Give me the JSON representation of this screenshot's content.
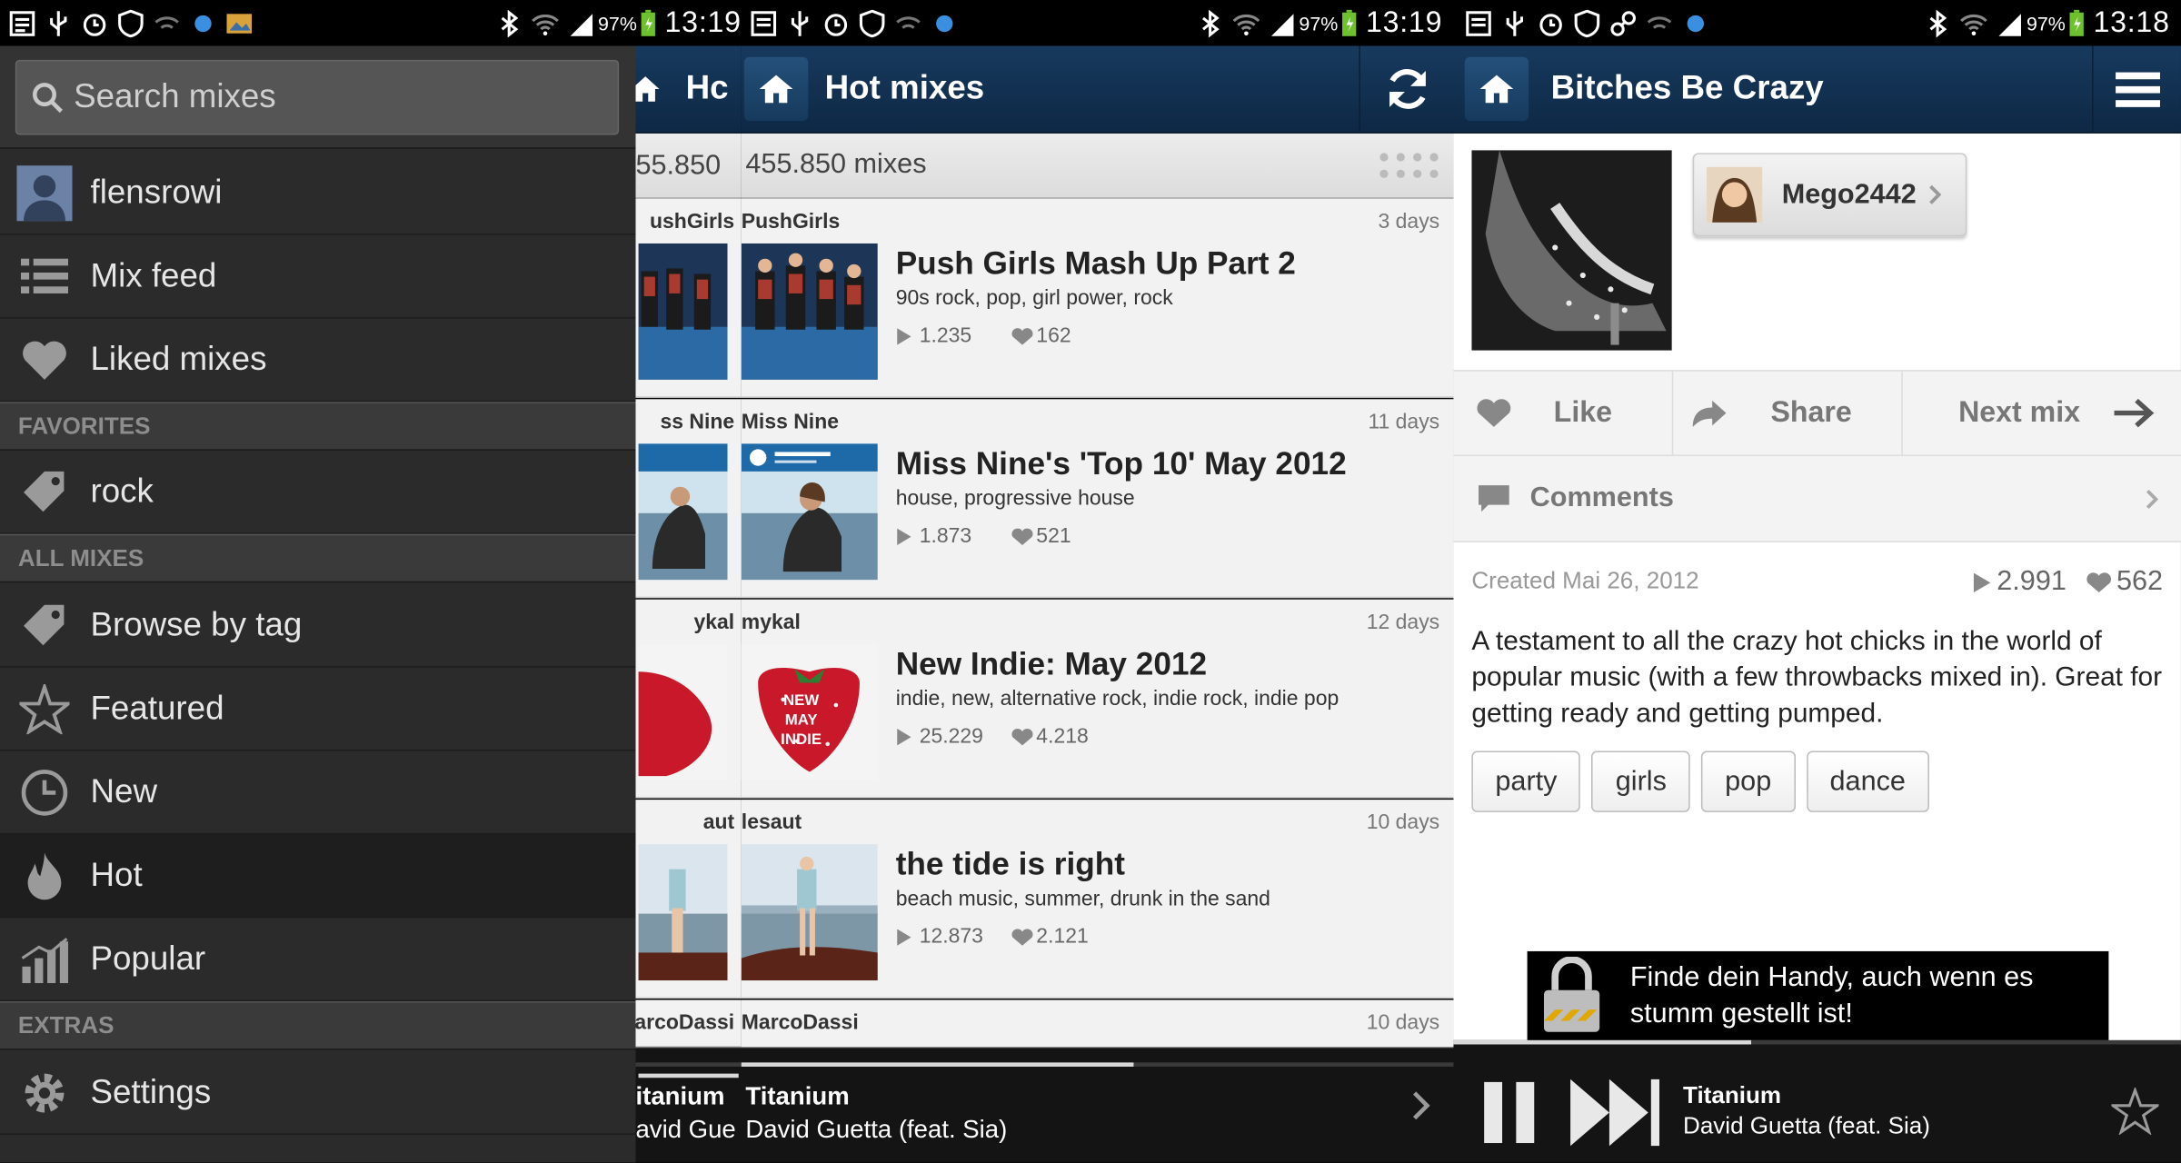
{
  "status_left": {
    "battery": "97%",
    "time": "13:19"
  },
  "status_middle": {
    "battery": "97%",
    "time": "13:19"
  },
  "status_right": {
    "battery": "97%",
    "time": "13:18"
  },
  "drawer": {
    "search_placeholder": "Search mixes",
    "user": "flensrowi",
    "items_top": [
      {
        "label": "Mix feed",
        "icon": "list-icon"
      },
      {
        "label": "Liked mixes",
        "icon": "heart-icon"
      }
    ],
    "favorites_header": "FAVORITES",
    "favorites": [
      {
        "label": "rock",
        "icon": "tag-icon"
      }
    ],
    "all_mixes_header": "ALL MIXES",
    "all_mixes": [
      {
        "label": "Browse by tag",
        "icon": "tag-icon"
      },
      {
        "label": "Featured",
        "icon": "star-icon"
      },
      {
        "label": "New",
        "icon": "clock-icon"
      },
      {
        "label": "Hot",
        "icon": "flame-icon"
      },
      {
        "label": "Popular",
        "icon": "chart-icon"
      }
    ],
    "extras_header": "EXTRAS",
    "extras": [
      {
        "label": "Settings",
        "icon": "gear-icon"
      }
    ]
  },
  "hot": {
    "title": "Hot mixes",
    "title_ghost": "Hc",
    "count": "455.850 mixes",
    "count_ghost": "55.850",
    "mixes": [
      {
        "user": "PushGirls",
        "user_ghost": "ushGirls",
        "age": "3 days",
        "title": "Push Girls Mash Up Part 2",
        "tags": "90s rock, pop, girl power, rock",
        "plays": "1.235",
        "likes": "162"
      },
      {
        "user": "Miss Nine",
        "user_ghost": "ss Nine",
        "age": "11 days",
        "title": "Miss Nine's 'Top 10' May 2012",
        "tags": "house, progressive house",
        "plays": "1.873",
        "likes": "521"
      },
      {
        "user": "mykal",
        "user_ghost": "ykal",
        "age": "12 days",
        "title": "New Indie: May 2012",
        "tags": "indie, new, alternative rock, indie rock, indie pop",
        "plays": "25.229",
        "likes": "4.218",
        "art_text": [
          "NEW",
          "MAY",
          "INDIE"
        ]
      },
      {
        "user": "lesaut",
        "user_ghost": "aut",
        "age": "10 days",
        "title": "the tide is right",
        "tags": "beach music, summer, drunk in the sand",
        "plays": "12.873",
        "likes": "2.121"
      },
      {
        "user": "MarcoDassi",
        "user_ghost": "arcoDassi",
        "age": "10 days"
      }
    ],
    "player": {
      "track": "Titanium",
      "artist": "David Guetta (feat. Sia)",
      "track_ghost": "itanium",
      "artist_ghost": "avid Gue",
      "progress": 0.55
    }
  },
  "detail": {
    "title": "Bitches Be Crazy",
    "creator": "Mego2442",
    "actions": {
      "like": "Like",
      "share": "Share",
      "next": "Next mix"
    },
    "comments": "Comments",
    "created": "Created Mai 26, 2012",
    "plays": "2.991",
    "likes": "562",
    "description": "A testament to all the crazy hot chicks in the world of popular music (with a few throwbacks mixed in). Great for getting ready and getting pumped.",
    "tags": [
      "party",
      "girls",
      "pop",
      "dance"
    ],
    "ad": "Finde dein Handy, auch wenn es stumm gestellt ist!",
    "player": {
      "track": "Titanium",
      "artist": "David Guetta (feat. Sia)",
      "progress": 0.41
    }
  }
}
